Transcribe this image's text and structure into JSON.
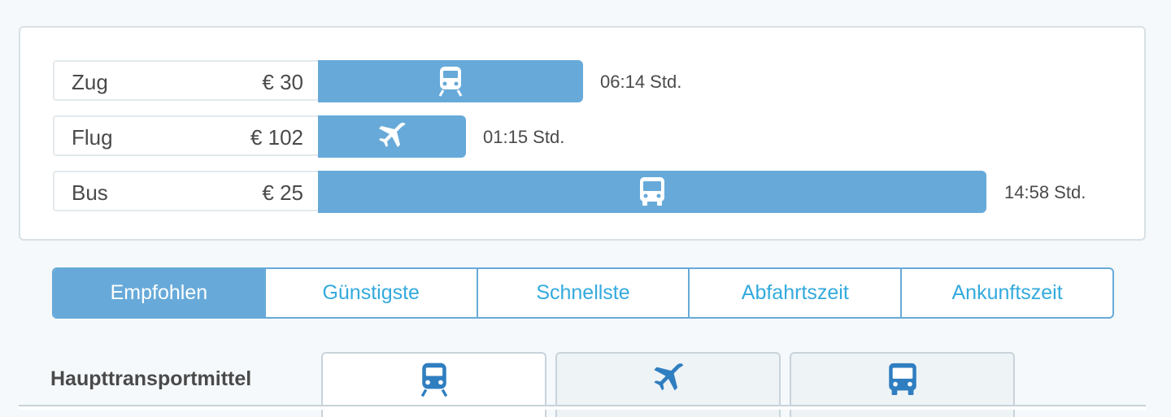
{
  "comparison": {
    "rows": [
      {
        "mode": "Zug",
        "price": "€ 30",
        "duration": "06:14 Std.",
        "icon": "train-icon",
        "duration_hours": 6.23
      },
      {
        "mode": "Flug",
        "price": "€ 102",
        "duration": "01:15 Std.",
        "icon": "plane-icon",
        "duration_hours": 1.25
      },
      {
        "mode": "Bus",
        "price": "€ 25",
        "duration": "14:58 Std.",
        "icon": "bus-icon",
        "duration_hours": 14.97
      }
    ]
  },
  "sort": {
    "tabs": [
      "Empfohlen",
      "Günstigste",
      "Schnellste",
      "Abfahrtszeit",
      "Ankunftszeit"
    ],
    "active_index": 0
  },
  "transport": {
    "label": "Haupttransportmittel",
    "tabs": [
      "train-icon",
      "plane-icon",
      "bus-icon"
    ],
    "active_index": 0
  },
  "colors": {
    "bar": "#67aad9",
    "accent_text": "#33aadd",
    "icon_blue": "#2f7ec0"
  }
}
